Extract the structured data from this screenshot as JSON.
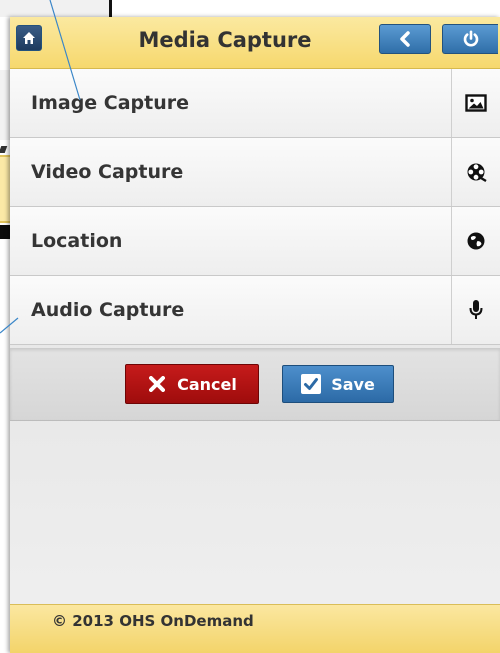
{
  "header": {
    "title": "Media Capture",
    "home_icon": "home-icon",
    "back_icon": "chevron-left-icon",
    "power_icon": "power-icon"
  },
  "menu": {
    "items": [
      {
        "label": "Image Capture",
        "icon": "image-icon"
      },
      {
        "label": "Video Capture",
        "icon": "film-reel-icon"
      },
      {
        "label": "Location",
        "icon": "globe-icon"
      },
      {
        "label": "Audio Capture",
        "icon": "microphone-icon"
      }
    ]
  },
  "actions": {
    "cancel_label": "Cancel",
    "save_label": "Save"
  },
  "footer": {
    "copyright": "© 2013 OHS OnDemand"
  },
  "colors": {
    "header_bg": "#f6d86e",
    "button_blue": "#2f6ea8",
    "cancel_red": "#b01313",
    "accent_line": "#3a86c8"
  }
}
